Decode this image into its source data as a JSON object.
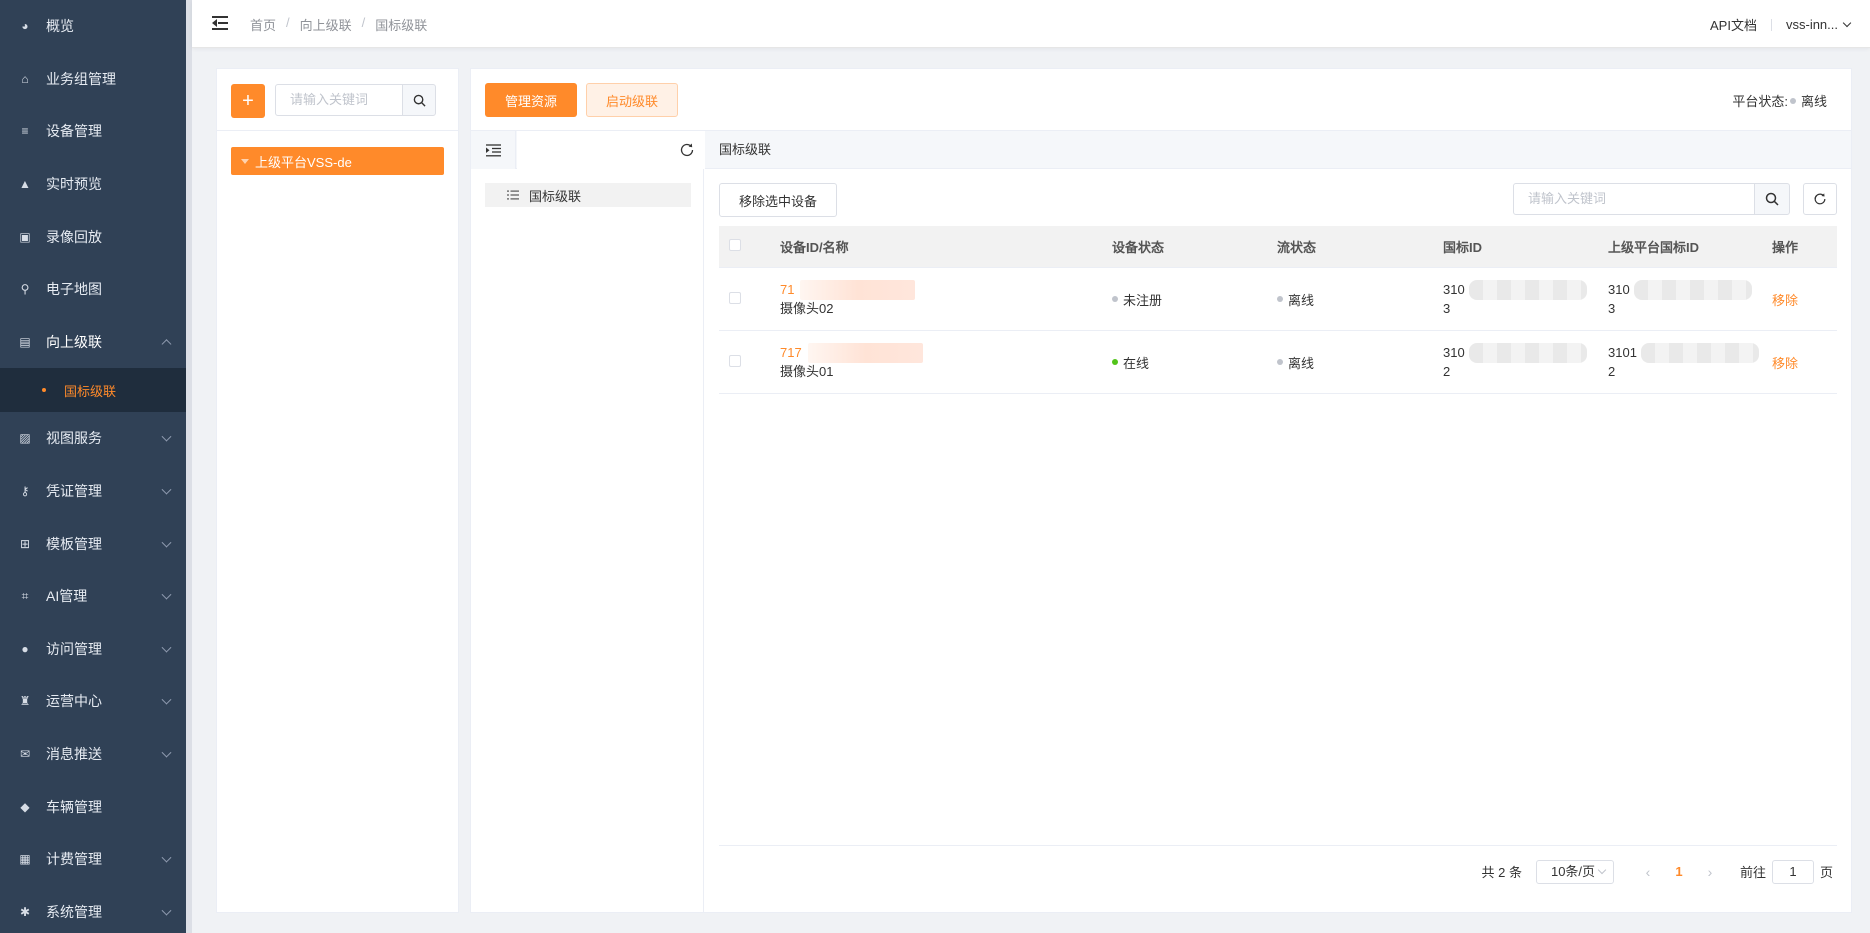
{
  "sidebar": {
    "items": [
      {
        "label": "概览",
        "icon": "dashboard-icon",
        "expandable": false
      },
      {
        "label": "业务组管理",
        "icon": "org-icon",
        "expandable": false
      },
      {
        "label": "设备管理",
        "icon": "device-icon",
        "expandable": false
      },
      {
        "label": "实时预览",
        "icon": "camera-icon",
        "expandable": false
      },
      {
        "label": "录像回放",
        "icon": "playback-icon",
        "expandable": false
      },
      {
        "label": "电子地图",
        "icon": "map-pin-icon",
        "expandable": false
      },
      {
        "label": "向上级联",
        "icon": "cascade-icon",
        "expandable": true,
        "open": true
      },
      {
        "label": "视图服务",
        "icon": "image-icon",
        "expandable": true
      },
      {
        "label": "凭证管理",
        "icon": "key-icon",
        "expandable": true
      },
      {
        "label": "模板管理",
        "icon": "grid-icon",
        "expandable": true
      },
      {
        "label": "AI管理",
        "icon": "ai-scan-icon",
        "expandable": true
      },
      {
        "label": "访问管理",
        "icon": "user-icon",
        "expandable": true
      },
      {
        "label": "运营中心",
        "icon": "operation-icon",
        "expandable": true
      },
      {
        "label": "消息推送",
        "icon": "inbox-icon",
        "expandable": true
      },
      {
        "label": "车辆管理",
        "icon": "car-icon",
        "expandable": false
      },
      {
        "label": "计费管理",
        "icon": "billing-icon",
        "expandable": true
      },
      {
        "label": "系统管理",
        "icon": "gear-icon",
        "expandable": true
      }
    ],
    "active_sub": "国标级联"
  },
  "header": {
    "breadcrumb": [
      "首页",
      "向上级联",
      "国标级联"
    ],
    "api_docs": "API文档",
    "user": "vss-inn..."
  },
  "left_panel": {
    "add_label": "+",
    "search_placeholder": "请输入关键词",
    "tree_node": "上级平台VSS-de"
  },
  "main": {
    "manage_button": "管理资源",
    "start_button": "启动级联",
    "platform_status_label": "平台状态:",
    "platform_status_value": "离线",
    "tree_item": "国标级联",
    "section_title": "国标级联",
    "remove_selected": "移除选中设备",
    "search_placeholder": "请输入关键词"
  },
  "table": {
    "columns": [
      "设备ID/名称",
      "设备状态",
      "流状态",
      "国标ID",
      "上级平台国标ID",
      "操作"
    ],
    "rows": [
      {
        "id": "71",
        "name": "摄像头02",
        "device_status": "未注册",
        "device_status_color": "#c0c4cc",
        "stream_status": "离线",
        "gb_id_top": "310",
        "gb_id_bottom": "3",
        "parent_gb_id_top": "310",
        "parent_gb_id_bottom": "3",
        "action": "移除"
      },
      {
        "id": "717",
        "name": "摄像头01",
        "device_status": "在线",
        "device_status_color": "#52c41a",
        "stream_status": "离线",
        "gb_id_top": "310",
        "gb_id_bottom": "2",
        "parent_gb_id_top": "3101",
        "parent_gb_id_bottom": "2",
        "action": "移除"
      }
    ]
  },
  "pagination": {
    "total": "共 2 条",
    "page_size": "10条/页",
    "prev": "‹",
    "current_page": "1",
    "next": "›",
    "goto_label": "前往",
    "goto_value": "1",
    "goto_suffix": "页"
  },
  "colors": {
    "accent": "#ff8a2a",
    "sidebar_bg": "#304156",
    "sidebar_active_bg": "#1f2d3d"
  }
}
